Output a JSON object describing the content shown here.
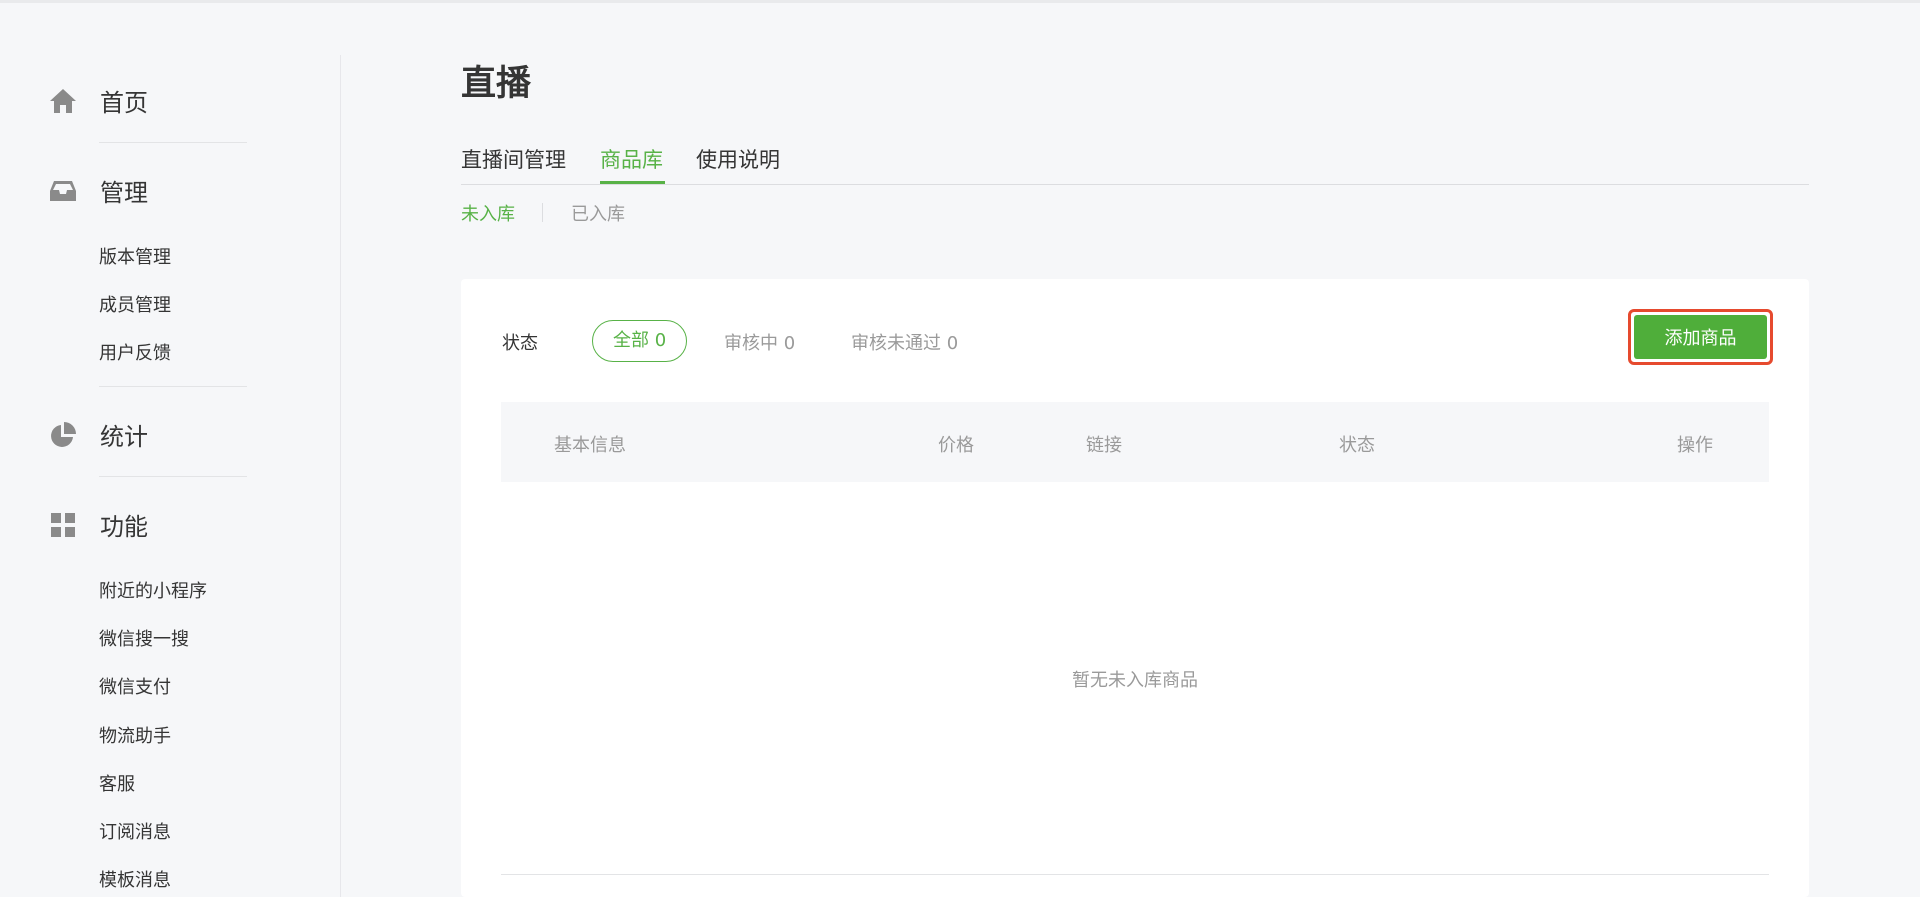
{
  "sidebar": {
    "home": {
      "label": "首页",
      "icon": "home-icon"
    },
    "manage": {
      "label": "管理",
      "icon": "inbox-icon",
      "items": [
        "版本管理",
        "成员管理",
        "用户反馈"
      ]
    },
    "stats": {
      "label": "统计",
      "icon": "pie-chart-icon"
    },
    "features": {
      "label": "功能",
      "icon": "grid-icon",
      "items": [
        "附近的小程序",
        "微信搜一搜",
        "微信支付",
        "物流助手",
        "客服",
        "订阅消息",
        "模板消息"
      ]
    }
  },
  "main": {
    "title": "直播",
    "tabs": [
      "直播间管理",
      "商品库",
      "使用说明"
    ],
    "active_tab": "商品库",
    "subtabs": [
      "未入库",
      "已入库"
    ],
    "active_subtab": "未入库",
    "filter": {
      "label": "状态",
      "options": [
        "全部 0",
        "审核中 0",
        "审核未通过 0"
      ],
      "selected": "全部 0"
    },
    "add_button": "添加商品",
    "table": {
      "columns": [
        "基本信息",
        "价格",
        "链接",
        "状态",
        "操作"
      ],
      "empty_text": "暂无未入库商品"
    }
  },
  "colors": {
    "accent": "#58b247",
    "button": "#4fae3a",
    "highlight_border": "#e64a2e",
    "muted_text": "#9a9a9a"
  }
}
